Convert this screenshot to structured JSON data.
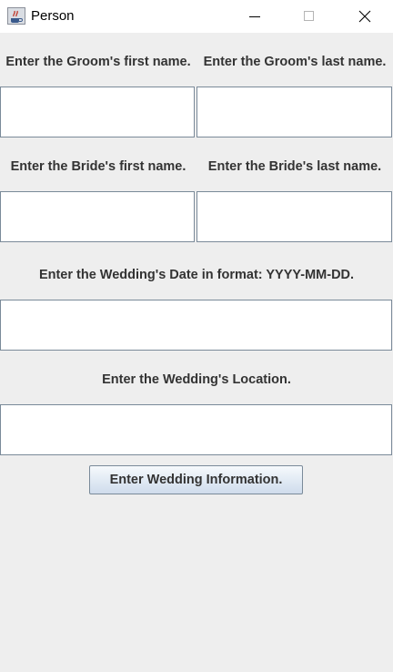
{
  "window": {
    "title": "Person",
    "icon": "java-cup-icon",
    "controls": [
      "minimize-icon",
      "maximize-icon",
      "close-icon"
    ]
  },
  "form": {
    "groom_first_label": "Enter the Groom's first name.",
    "groom_last_label": "Enter the Groom's last name.",
    "bride_first_label": "Enter the Bride's first name.",
    "bride_last_label": "Enter the Bride's last name.",
    "date_label": "Enter the Wedding's Date in format: YYYY-MM-DD.",
    "location_label": "Enter the Wedding's Location.",
    "groom_first_value": "",
    "groom_last_value": "",
    "bride_first_value": "",
    "bride_last_value": "",
    "date_value": "",
    "location_value": "",
    "submit_label": "Enter Wedding Information."
  }
}
